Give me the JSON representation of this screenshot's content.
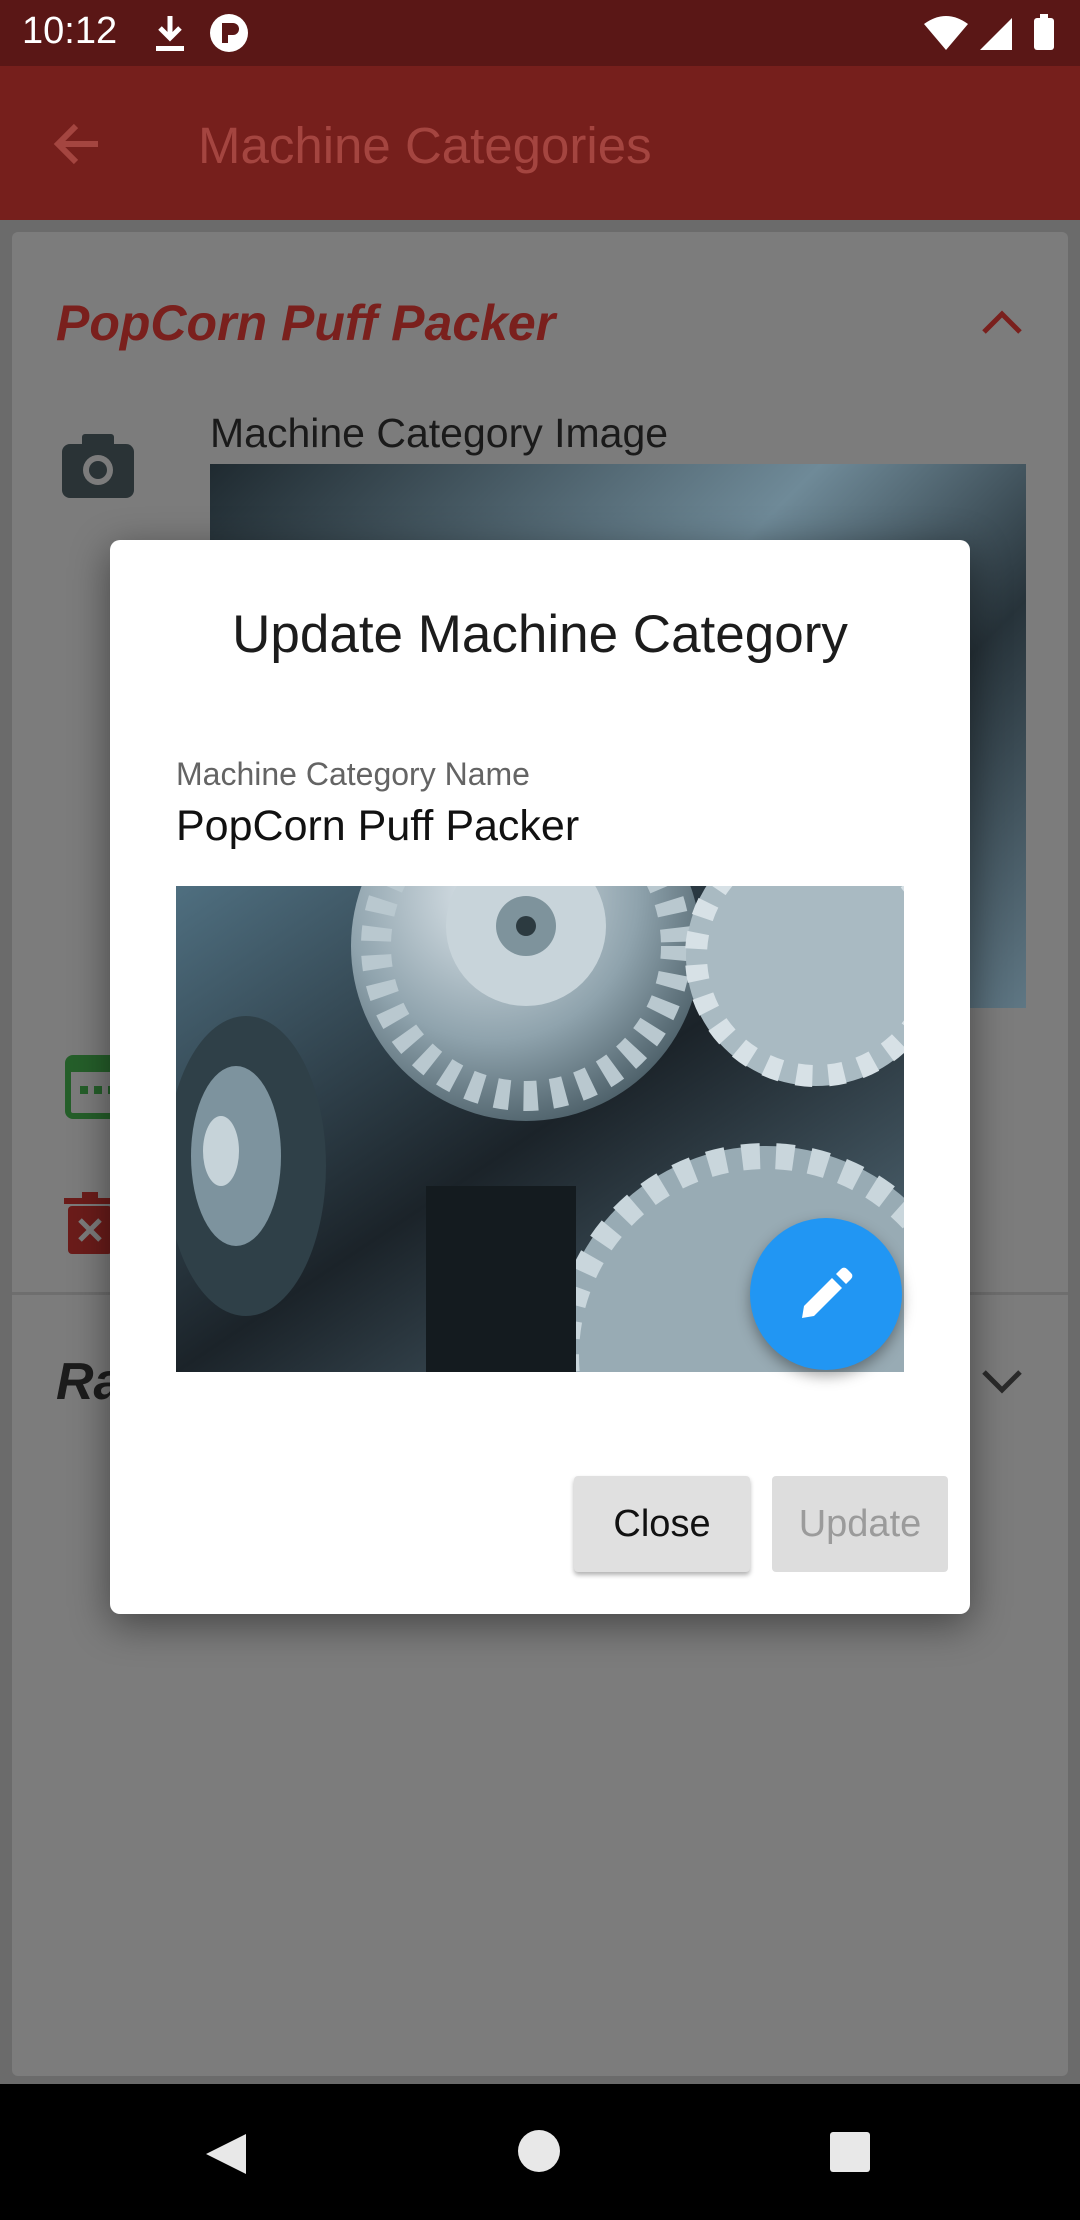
{
  "status_bar": {
    "time": "10:12",
    "icons": [
      "download-icon",
      "r-icon",
      "wifi-icon",
      "signal-icon",
      "battery-icon"
    ]
  },
  "app_bar": {
    "title": "Machine Categories",
    "back_icon": "arrow-back-icon",
    "color": "#761f1c"
  },
  "background": {
    "card_title": "PopCorn Puff Packer",
    "image_label": "Machine Category Image",
    "second_card_title": "Ra",
    "icons": [
      "camera-icon",
      "calendar-icon",
      "delete-icon",
      "chevron-up-icon",
      "chevron-down-icon"
    ]
  },
  "dialog": {
    "title": "Update Machine Category",
    "field_label": "Machine Category Name",
    "field_value": "PopCorn Puff Packer",
    "close_label": "Close",
    "update_label": "Update",
    "edit_icon": "pencil-icon",
    "accent": "#2196f3"
  },
  "nav_bar": {
    "icons": [
      "nav-back-icon",
      "nav-home-icon",
      "nav-recent-icon"
    ]
  }
}
